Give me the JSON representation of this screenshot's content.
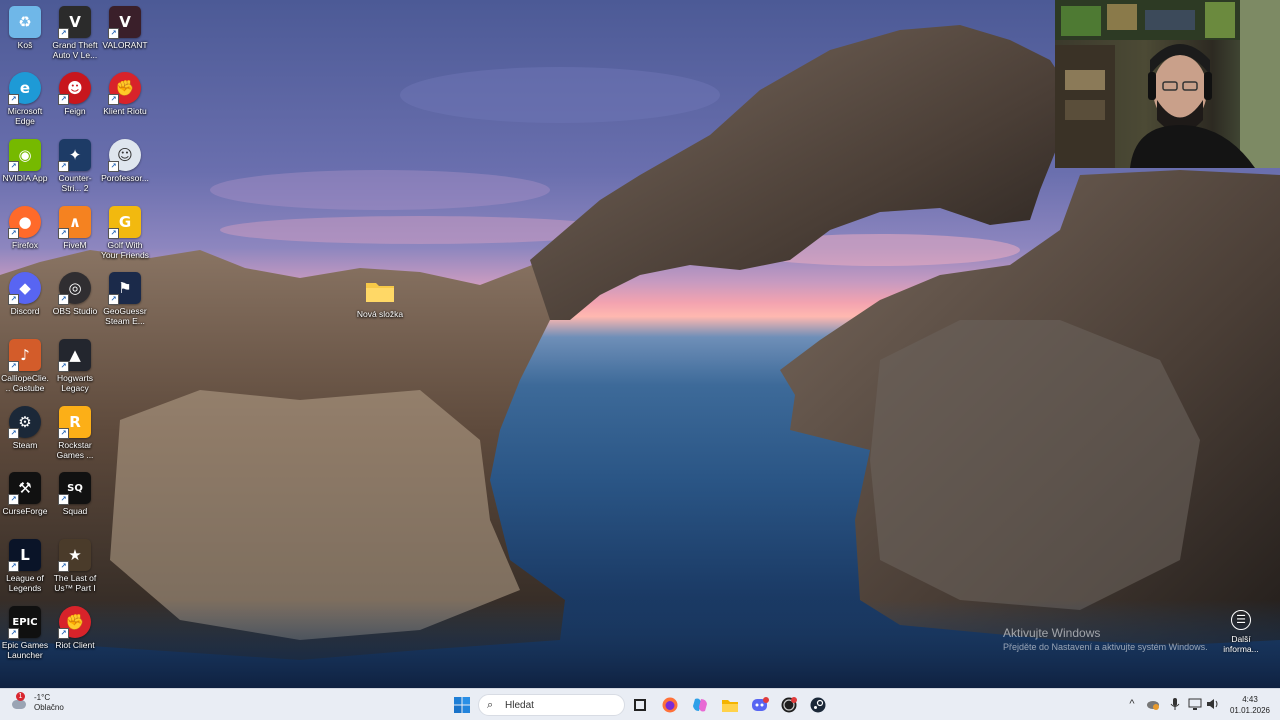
{
  "desktop": {
    "icons": [
      {
        "label": "Koš",
        "icon": "recycle-bin-icon",
        "color": "#6fb7e8"
      },
      {
        "label": "Grand Theft Auto V Le...",
        "icon": "gta-v-icon",
        "color": "#2b2b2b"
      },
      {
        "label": "VALORANT",
        "icon": "valorant-icon",
        "color": "#3a1f2a"
      },
      {
        "label": "Microsoft Edge",
        "icon": "edge-icon",
        "color": "#1e9ad6"
      },
      {
        "label": "Feign",
        "icon": "feign-icon",
        "color": "#c8161d"
      },
      {
        "label": "Klient Riotu",
        "icon": "riot-client-icon",
        "color": "#d8232a"
      },
      {
        "label": "NVIDIA App",
        "icon": "nvidia-icon",
        "color": "#76b900"
      },
      {
        "label": "Counter-Stri... 2",
        "icon": "counter-strike-icon",
        "color": "#1d3b66"
      },
      {
        "label": "Porofessor...",
        "icon": "porofessor-icon",
        "color": "#dfe6ee"
      },
      {
        "label": "Firefox",
        "icon": "firefox-icon",
        "color": "#ff6a2a"
      },
      {
        "label": "FiveM",
        "icon": "fivem-icon",
        "color": "#f58220"
      },
      {
        "label": "Golf With Your Friends",
        "icon": "golf-icon",
        "color": "#f2b90f"
      },
      {
        "label": "Discord",
        "icon": "discord-icon",
        "color": "#5865f2"
      },
      {
        "label": "OBS Studio",
        "icon": "obs-icon",
        "color": "#302e31"
      },
      {
        "label": "GeoGuessr Steam E...",
        "icon": "geoguessr-icon",
        "color": "#1b2a4a"
      },
      {
        "label": "CalliopeClie... Castube",
        "icon": "calliope-icon",
        "color": "#d35c2a"
      },
      {
        "label": "Hogwarts Legacy",
        "icon": "hogwarts-icon",
        "color": "#23262e"
      },
      {
        "label": "",
        "icon": "none",
        "color": ""
      },
      {
        "label": "Steam",
        "icon": "steam-icon",
        "color": "#1b2838"
      },
      {
        "label": "Rockstar Games ...",
        "icon": "rockstar-icon",
        "color": "#fcaf17"
      },
      {
        "label": "",
        "icon": "none",
        "color": ""
      },
      {
        "label": "CurseForge",
        "icon": "curseforge-icon",
        "color": "#111111"
      },
      {
        "label": "Squad",
        "icon": "squad-icon",
        "color": "#111111"
      },
      {
        "label": "",
        "icon": "none",
        "color": ""
      },
      {
        "label": "League of Legends",
        "icon": "league-icon",
        "color": "#0a1428"
      },
      {
        "label": "The Last of Us™ Part I",
        "icon": "tlou-icon",
        "color": "#4a3b2a"
      },
      {
        "label": "",
        "icon": "none",
        "color": ""
      },
      {
        "label": "Epic Games Launcher",
        "icon": "epic-icon",
        "color": "#101010"
      },
      {
        "label": "Riot Client",
        "icon": "riot-client-icon",
        "color": "#d8232a"
      }
    ],
    "folder": {
      "label": "Nová složka",
      "icon": "folder-icon"
    }
  },
  "watermark": {
    "title": "Aktivujte Windows",
    "subtitle": "Přejděte do Nastavení a aktivujte systém Windows."
  },
  "more_info": {
    "label": "Další informa...",
    "icon": "info-circle-icon"
  },
  "taskbar": {
    "weather": {
      "temp": "-1°C",
      "condition": "Oblačno",
      "badge": "1"
    },
    "search_placeholder": "Hledat",
    "apps": [
      "start-icon",
      "task-view-icon",
      "firefox-icon",
      "copilot-icon",
      "file-explorer-icon",
      "discord-icon",
      "obs-icon",
      "steam-icon"
    ],
    "tray": {
      "chevron": "^",
      "clock_time": "4:43",
      "clock_date": "01.01.2026"
    }
  }
}
